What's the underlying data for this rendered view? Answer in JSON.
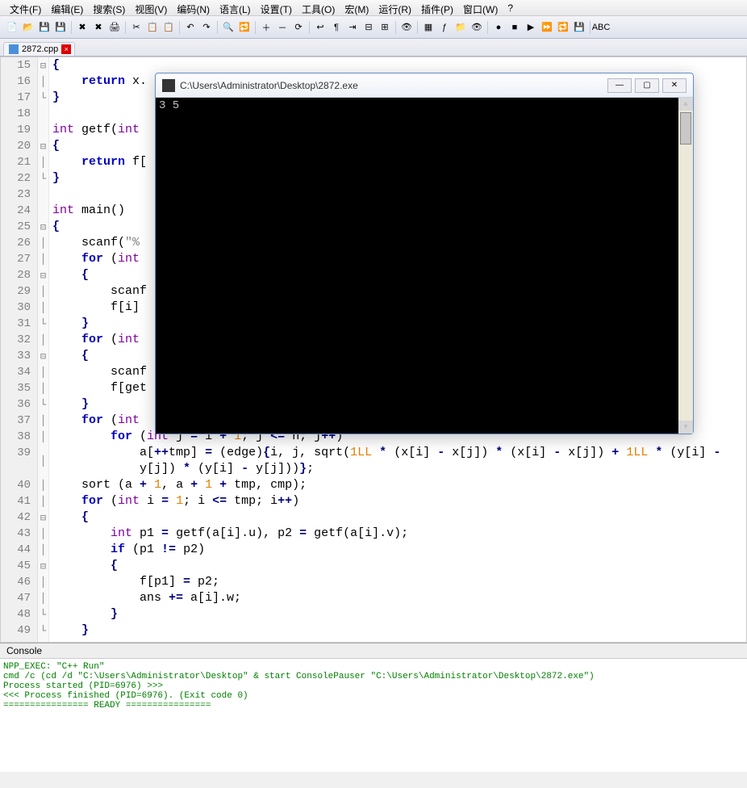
{
  "menu": {
    "file": "文件(F)",
    "edit": "编辑(E)",
    "search": "搜索(S)",
    "view": "视图(V)",
    "encoding": "编码(N)",
    "language": "语言(L)",
    "settings": "设置(T)",
    "tools": "工具(O)",
    "macro": "宏(M)",
    "run": "运行(R)",
    "plugins": "插件(P)",
    "window": "窗口(W)",
    "help": "?"
  },
  "tab": {
    "filename": "2872.cpp",
    "close": "×"
  },
  "toolbar_icons": [
    "new-file",
    "open",
    "save",
    "save-all",
    "",
    "close",
    "close-all",
    "print",
    "",
    "cut",
    "copy",
    "paste",
    "",
    "undo",
    "redo",
    "",
    "find",
    "replace",
    "",
    "zoom-in",
    "zoom-out",
    "sync",
    "",
    "wordwrap",
    "all-chars",
    "indent",
    "fold",
    "unfold",
    "",
    "hide-lines",
    "",
    "doc-map",
    "func-list",
    "folder",
    "monitor",
    "",
    "record",
    "stop",
    "play",
    "fast",
    "loop",
    "save-macro",
    "",
    "spell"
  ],
  "code_lines": [
    {
      "n": 15,
      "fold": "⊟",
      "html": "<span class='br'>{</span>"
    },
    {
      "n": 16,
      "fold": "│",
      "html": "    <span class='kw'>return</span> x."
    },
    {
      "n": 17,
      "fold": "└",
      "html": "<span class='br'>}</span>"
    },
    {
      "n": 18,
      "fold": "",
      "html": ""
    },
    {
      "n": 19,
      "fold": "",
      "html": "<span class='type'>int</span> getf(<span class='type'>int</span>"
    },
    {
      "n": 20,
      "fold": "⊟",
      "html": "<span class='br'>{</span>"
    },
    {
      "n": 21,
      "fold": "│",
      "html": "    <span class='kw'>return</span> f["
    },
    {
      "n": 22,
      "fold": "└",
      "html": "<span class='br'>}</span>"
    },
    {
      "n": 23,
      "fold": "",
      "html": ""
    },
    {
      "n": 24,
      "fold": "",
      "html": "<span class='type'>int</span> main()"
    },
    {
      "n": 25,
      "fold": "⊟",
      "html": "<span class='br'>{</span>"
    },
    {
      "n": 26,
      "fold": "│",
      "html": "    scanf(<span class='str'>\"%</span>"
    },
    {
      "n": 27,
      "fold": "│",
      "html": "    <span class='kw'>for</span> (<span class='type'>int</span>"
    },
    {
      "n": 28,
      "fold": "⊟",
      "html": "    <span class='br'>{</span>"
    },
    {
      "n": 29,
      "fold": "│",
      "html": "        scanf"
    },
    {
      "n": 30,
      "fold": "│",
      "html": "        f[i]"
    },
    {
      "n": 31,
      "fold": "└",
      "html": "    <span class='br'>}</span>"
    },
    {
      "n": 32,
      "fold": "│",
      "html": "    <span class='kw'>for</span> (<span class='type'>int</span>"
    },
    {
      "n": 33,
      "fold": "⊟",
      "html": "    <span class='br'>{</span>"
    },
    {
      "n": 34,
      "fold": "│",
      "html": "        scanf"
    },
    {
      "n": 35,
      "fold": "│",
      "html": "        f[get"
    },
    {
      "n": 36,
      "fold": "└",
      "html": "    <span class='br'>}</span>"
    },
    {
      "n": 37,
      "fold": "│",
      "html": "    <span class='kw'>for</span> (<span class='type'>int</span>"
    },
    {
      "n": 38,
      "fold": "│",
      "html": "        <span class='kw'>for</span> (<span class='type'>int</span> j <span class='op'>=</span> i <span class='op'>+</span> <span class='num'>1</span>; j <span class='op'>&lt;=</span> n; j<span class='op'>++</span>)"
    },
    {
      "n": 39,
      "fold": "│",
      "html": "            a[<span class='op'>++</span>tmp] <span class='op'>=</span> (edge)<span class='br'>{</span>i, j, sqrt(<span class='num'>1LL</span> <span class='op'>*</span> (x[i] <span class='op'>-</span> x[j]) <span class='op'>*</span> (x[i] <span class='op'>-</span> x[j]) <span class='op'>+</span> <span class='num'>1LL</span> <span class='op'>*</span> (y[i] <span class='op'>-</span>\n            y[j]) <span class='op'>*</span> (y[i] <span class='op'>-</span> y[j]))<span class='br'>}</span>;"
    },
    {
      "n": 40,
      "fold": "│",
      "html": "    sort (a <span class='op'>+</span> <span class='num'>1</span>, a <span class='op'>+</span> <span class='num'>1</span> <span class='op'>+</span> tmp, cmp);"
    },
    {
      "n": 41,
      "fold": "│",
      "html": "    <span class='kw'>for</span> (<span class='type'>int</span> i <span class='op'>=</span> <span class='num'>1</span>; i <span class='op'>&lt;=</span> tmp; i<span class='op'>++</span>)"
    },
    {
      "n": 42,
      "fold": "⊟",
      "html": "    <span class='br'>{</span>"
    },
    {
      "n": 43,
      "fold": "│",
      "html": "        <span class='type'>int</span> p1 <span class='op'>=</span> getf(a[i].u), p2 <span class='op'>=</span> getf(a[i].v);"
    },
    {
      "n": 44,
      "fold": "│",
      "html": "        <span class='kw'>if</span> (p1 <span class='op'>!=</span> p2)"
    },
    {
      "n": 45,
      "fold": "⊟",
      "html": "        <span class='br'>{</span>"
    },
    {
      "n": 46,
      "fold": "│",
      "html": "            f[p1] <span class='op'>=</span> p2;"
    },
    {
      "n": 47,
      "fold": "│",
      "html": "            ans <span class='op'>+=</span> a[i].w;"
    },
    {
      "n": 48,
      "fold": "└",
      "html": "        <span class='br'>}</span>"
    },
    {
      "n": 49,
      "fold": "└",
      "html": "    <span class='br'>}</span>"
    }
  ],
  "console": {
    "title": "Console",
    "lines": [
      "NPP_EXEC: \"C++ Run\"",
      "cmd /c (cd /d \"C:\\Users\\Administrator\\Desktop\" & start ConsolePauser \"C:\\Users\\Administrator\\Desktop\\2872.exe\")",
      "Process started (PID=6976) >>>",
      "<<< Process finished (PID=6976). (Exit code 0)",
      "================ READY ================"
    ]
  },
  "overlay": {
    "title": "C:\\Users\\Administrator\\Desktop\\2872.exe",
    "output": "3  5",
    "btn_min": "—",
    "btn_max": "▢",
    "btn_close": "✕"
  }
}
